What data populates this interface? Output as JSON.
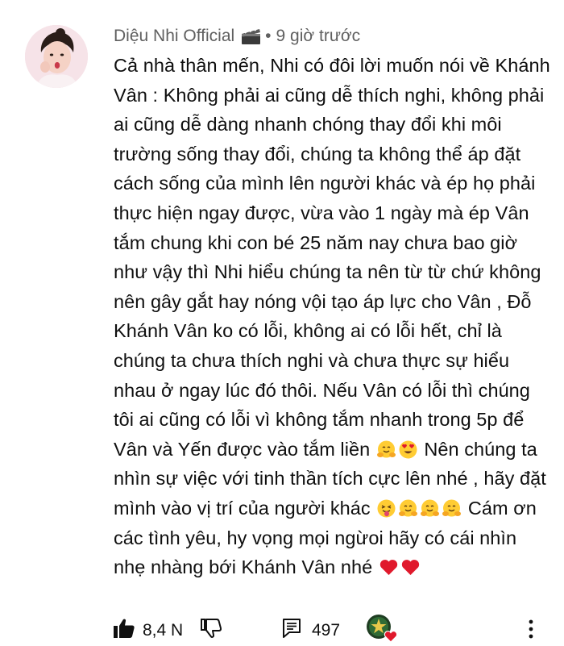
{
  "comment": {
    "author": "Diệu Nhi Official",
    "separator": "•",
    "time": "9 giờ trước",
    "text_before_emoji1": "Cả nhà thân mến, Nhi có đôi lời muốn nói về Khánh Vân : Không phải ai cũng dễ thích nghi, không phải ai cũng dễ dàng nhanh chóng thay đổi khi môi trường sống thay đổi, chúng ta không thể áp đặt cách sống của mình lên người khác và ép họ phải thực hiện ngay được, vừa vào 1 ngày mà ép Vân tắm chung khi con bé 25 năm nay chưa bao giờ như vậy thì Nhi hiểu chúng ta nên từ từ chứ không nên gây gắt hay nóng vội tạo áp lực cho Vân , Đỗ Khánh Vân ko có lỗi, không ai có lỗi hết, chỉ là chúng ta chưa thích nghi và chưa thực sự hiểu nhau ở ngay lúc đó thôi. Nếu Vân có lỗi thì chúng tôi ai cũng có lỗi vì không tắm nhanh trong 5p để Vân và Yến được vào tắm liền",
    "text_middle": "Nên chúng ta nhìn sự việc với tinh thần tích cực lên nhé , hãy đặt mình vào vị trí của người khác",
    "text_end": "Cám ơn các tình yêu, hy vọng mọi ngừoi hãy có cái nhìn nhẹ nhàng bới Khánh Vân nhé"
  },
  "actions": {
    "likes": "8,4 N",
    "replies": "497"
  },
  "icons": {
    "verified_badge": "clapperboard-icon",
    "like": "thumbs-up-icon",
    "dislike": "thumbs-down-icon",
    "reply": "comment-icon",
    "hearted": "creator-heart-icon",
    "more": "more-vertical-icon"
  },
  "colors": {
    "author_gray": "#606060",
    "text": "#0f0f0f",
    "heart_red": "#e0192c"
  }
}
